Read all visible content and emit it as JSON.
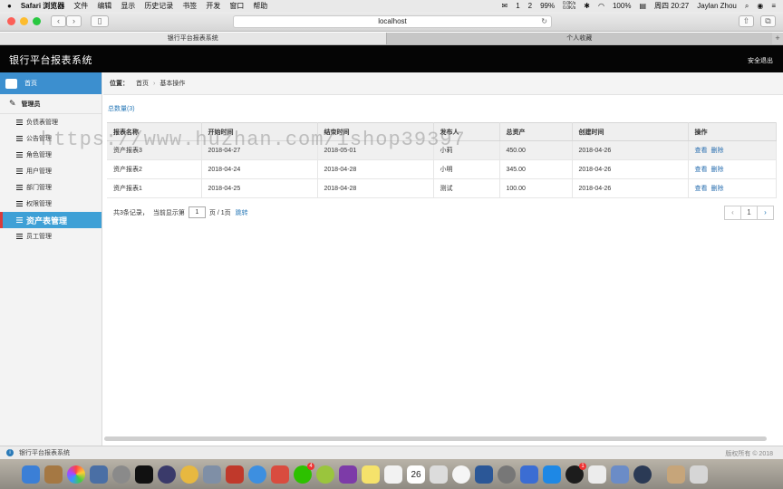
{
  "menubar": {
    "app": "Safari 浏览器",
    "items": [
      "文件",
      "编辑",
      "显示",
      "历史记录",
      "书签",
      "开发",
      "窗口",
      "帮助"
    ],
    "battery_cpu": "99%",
    "net_up": "0.0K/s",
    "net_down": "0.0K/s",
    "battery": "100%",
    "datetime": "周四 20:27",
    "user": "Jaylan Zhou",
    "badge1": "1",
    "badge2": "2"
  },
  "browser": {
    "address": "localhost",
    "tabs": [
      "银行平台报表系统",
      "个人收藏"
    ],
    "plus": "+"
  },
  "app": {
    "title": "银行平台报表系统",
    "logout": "安全退出"
  },
  "sidebar": {
    "home": "首页",
    "admin": "管理员",
    "items": [
      {
        "label": "负债表管理"
      },
      {
        "label": "公告管理"
      },
      {
        "label": "角色管理"
      },
      {
        "label": "用户管理"
      },
      {
        "label": "部门管理"
      },
      {
        "label": "权限管理"
      },
      {
        "label": "资产表管理",
        "active": true
      },
      {
        "label": "员工管理"
      }
    ]
  },
  "breadcrumb": {
    "prefix": "位置：",
    "home": "首页",
    "sep": "›",
    "current": "基本操作"
  },
  "summary": "总数量(3)",
  "table": {
    "headers": [
      "报表名称",
      "开始时间",
      "结束时间",
      "发布人",
      "总资产",
      "创建时间",
      "操作"
    ],
    "rows": [
      {
        "name": "资产报表3",
        "start": "2018-04-27",
        "end": "2018-05-01",
        "publisher": "小莉",
        "assets": "450.00",
        "created": "2018-04-26",
        "view": "查看",
        "del": "删除"
      },
      {
        "name": "资产报表2",
        "start": "2018-04-24",
        "end": "2018-04-28",
        "publisher": "小明",
        "assets": "345.00",
        "created": "2018-04-26",
        "view": "查看",
        "del": "删除"
      },
      {
        "name": "资产报表1",
        "start": "2018-04-25",
        "end": "2018-04-28",
        "publisher": "测试",
        "assets": "100.00",
        "created": "2018-04-26",
        "view": "查看",
        "del": "删除"
      }
    ]
  },
  "pagination": {
    "records": "共3条记录，",
    "current_label": "当前显示第",
    "page_value": "1",
    "page_of": "页 / 1页",
    "jump": "跳转",
    "prev": "‹",
    "page": "1",
    "next": "›"
  },
  "status": {
    "text": "银行平台报表系统",
    "copyright": "版权所有 © 2018"
  },
  "dock": {
    "calendar_day": "26",
    "badge_qq": "1",
    "badge_wechat": "4"
  },
  "watermark": "https://www.huzhan.com/ishop39397",
  "colors": {
    "header": "#050505",
    "accent": "#3ea0d6",
    "home": "#3c8fcf",
    "active_marker": "#d83b3b",
    "link": "#2a7ab8"
  }
}
